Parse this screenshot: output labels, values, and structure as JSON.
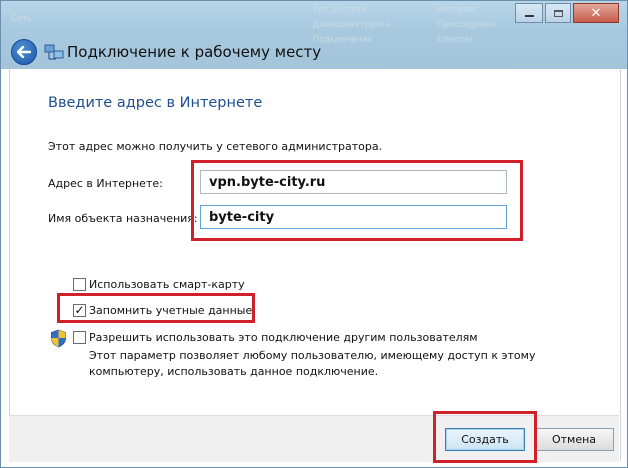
{
  "window": {
    "title": "Подключение к рабочему месту",
    "background_texts": [
      "Сеть",
      "Тип доступа",
      "Интернет",
      "Домашняя группа",
      "Присоединен",
      "Подключения",
      "Ethernet"
    ]
  },
  "page": {
    "heading": "Введите адрес в Интернете",
    "hint": "Этот адрес можно получить у сетевого администратора."
  },
  "form": {
    "address_label": "Адрес в Интернете:",
    "address_value": "vpn.byte-city.ru",
    "dest_label": "Имя объекта назначения:",
    "dest_value": "byte-city"
  },
  "options": {
    "smartcard": {
      "label": "Использовать смарт-карту",
      "checked": false
    },
    "remember": {
      "label": "Запомнить учетные данные",
      "checked": true
    },
    "share": {
      "label": "Разрешить использовать это подключение другим пользователям",
      "desc1": "Этот параметр позволяет любому пользователю, имеющему доступ к этому",
      "desc2": "компьютеру, использовать данное подключение.",
      "checked": false
    }
  },
  "buttons": {
    "create": "Создать",
    "cancel": "Отмена"
  },
  "colors": {
    "heading": "#1f4f8f",
    "highlight": "#d0202a",
    "titlebar": "#a8c9df"
  },
  "icons": [
    "back-arrow-icon",
    "network-icon",
    "uac-shield-icon",
    "minimize-icon",
    "maximize-icon",
    "close-icon"
  ]
}
